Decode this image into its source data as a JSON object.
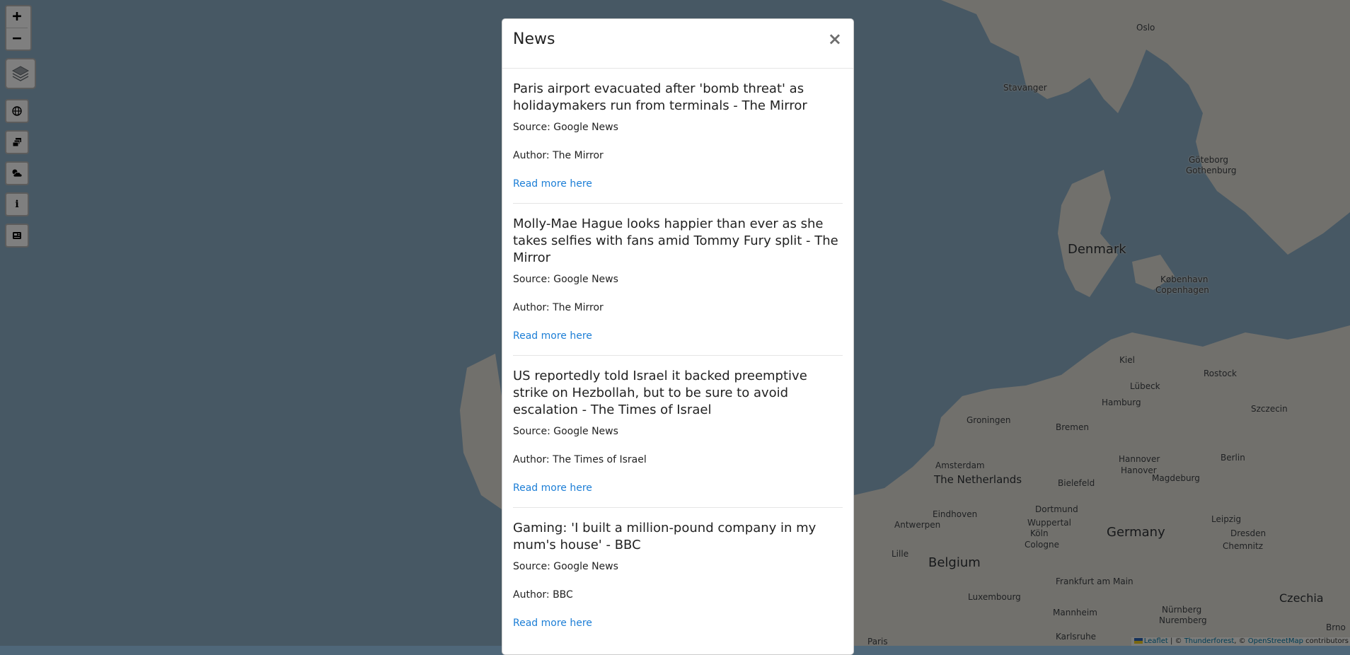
{
  "map": {
    "places": [
      {
        "name": "Oslo",
        "kind": "city"
      },
      {
        "name": "Stavanger",
        "kind": "city"
      },
      {
        "name": "Göteborg",
        "kind": "city"
      },
      {
        "name": "Gothenburg",
        "kind": "city"
      },
      {
        "name": "Denmark",
        "kind": "country"
      },
      {
        "name": "København",
        "kind": "city"
      },
      {
        "name": "Copenhagen",
        "kind": "city"
      },
      {
        "name": "Kiel",
        "kind": "city"
      },
      {
        "name": "Rostock",
        "kind": "city"
      },
      {
        "name": "Lübeck",
        "kind": "city"
      },
      {
        "name": "Hamburg",
        "kind": "city"
      },
      {
        "name": "Szczecin",
        "kind": "city"
      },
      {
        "name": "Groningen",
        "kind": "city"
      },
      {
        "name": "Bremen",
        "kind": "city"
      },
      {
        "name": "Amsterdam",
        "kind": "city"
      },
      {
        "name": "The Netherlands",
        "kind": "country-small"
      },
      {
        "name": "Hannover",
        "kind": "city"
      },
      {
        "name": "Hanover",
        "kind": "city"
      },
      {
        "name": "Berlin",
        "kind": "city"
      },
      {
        "name": "Bielefeld",
        "kind": "city"
      },
      {
        "name": "Magdeburg",
        "kind": "city"
      },
      {
        "name": "Eindhoven",
        "kind": "city"
      },
      {
        "name": "Dortmund",
        "kind": "city"
      },
      {
        "name": "Wuppertal",
        "kind": "city"
      },
      {
        "name": "Köln",
        "kind": "city"
      },
      {
        "name": "Cologne",
        "kind": "city"
      },
      {
        "name": "Antwerpen",
        "kind": "city"
      },
      {
        "name": "Leipzig",
        "kind": "city"
      },
      {
        "name": "Germany",
        "kind": "country"
      },
      {
        "name": "Dresden",
        "kind": "city"
      },
      {
        "name": "Lille",
        "kind": "city"
      },
      {
        "name": "Belgium",
        "kind": "country"
      },
      {
        "name": "Chemnitz",
        "kind": "city"
      },
      {
        "name": "Luxembourg",
        "kind": "city"
      },
      {
        "name": "Frankfurt am Main",
        "kind": "city"
      },
      {
        "name": "Czechia",
        "kind": "country"
      },
      {
        "name": "Mannheim",
        "kind": "city"
      },
      {
        "name": "Nürnberg",
        "kind": "city"
      },
      {
        "name": "Nuremberg",
        "kind": "city"
      },
      {
        "name": "Karlsruhe",
        "kind": "city"
      },
      {
        "name": "Brno",
        "kind": "city"
      },
      {
        "name": "Paris",
        "kind": "city"
      }
    ],
    "attribution": {
      "leaflet": "Leaflet",
      "sep1": " | © ",
      "thunderforest": "Thunderforest",
      "sep2": ", © ",
      "osm": "OpenStreetMap",
      "suffix": " contributors"
    }
  },
  "controls": {
    "zoom_in": "+",
    "zoom_out": "−",
    "tools": [
      {
        "name": "globe-icon"
      },
      {
        "name": "layers-stack-icon"
      },
      {
        "name": "weather-icon"
      },
      {
        "name": "info-icon",
        "glyph": "i"
      },
      {
        "name": "newspaper-icon"
      }
    ]
  },
  "modal": {
    "title": "News",
    "close": "×",
    "source_label": "Source:",
    "author_label": "Author:",
    "link_text": "Read more here",
    "link_color": "#1c7ed6",
    "items": [
      {
        "title": "Paris airport evacuated after 'bomb threat' as holidaymakers run from terminals - The Mirror",
        "source": "Google News",
        "author": "The Mirror"
      },
      {
        "title": "Molly-Mae Hague looks happier than ever as she takes selfies with fans amid Tommy Fury split - The Mirror",
        "source": "Google News",
        "author": "The Mirror"
      },
      {
        "title": "US reportedly told Israel it backed preemptive strike on Hezbollah, but to be sure to avoid escalation - The Times of Israel",
        "source": "Google News",
        "author": "The Times of Israel"
      },
      {
        "title": "Gaming: 'I built a million-pound company in my mum's house' - BBC",
        "source": "Google News",
        "author": "BBC"
      }
    ]
  }
}
